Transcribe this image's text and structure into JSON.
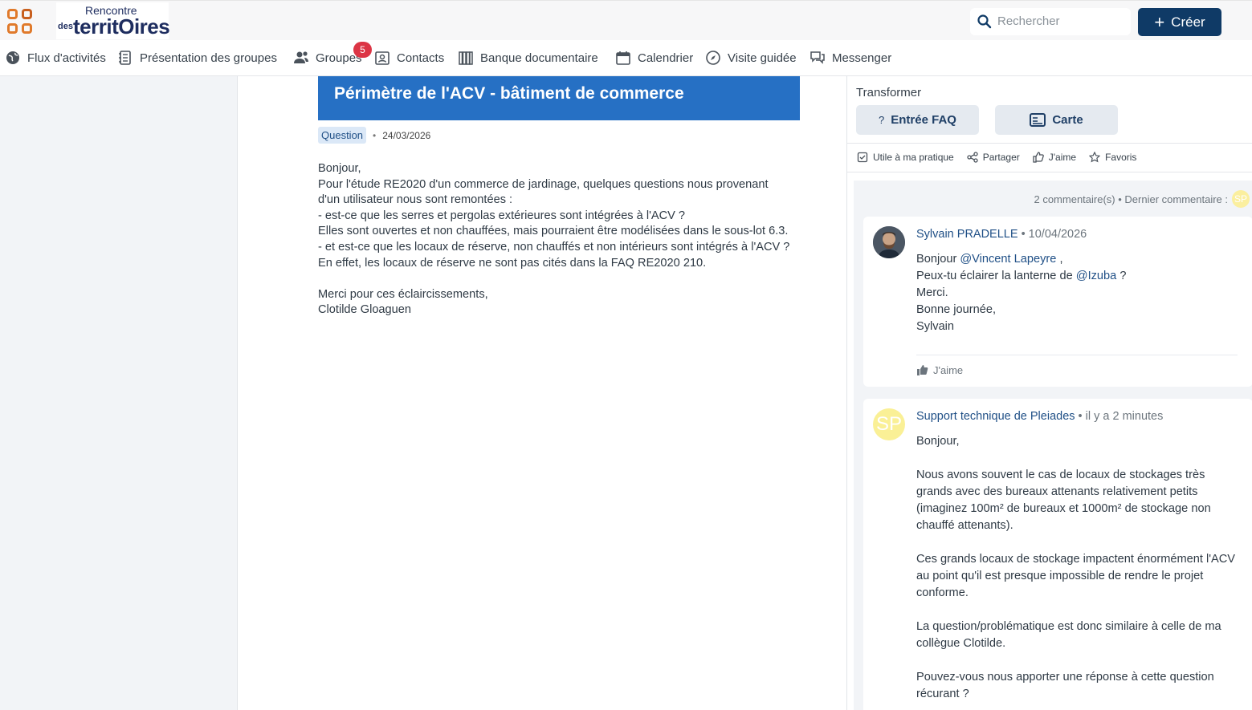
{
  "header": {
    "logo_top": "Rencontre",
    "logo_small": "des",
    "logo_main": "territOires",
    "search_placeholder": "Rechercher",
    "create_label": "Créer"
  },
  "nav": {
    "items": [
      {
        "label": "Flux d'activités",
        "icon": "globe-icon"
      },
      {
        "label": "Présentation des groupes",
        "icon": "notebook-icon"
      },
      {
        "label": "Groupes",
        "icon": "users-icon",
        "badge": "5"
      },
      {
        "label": "Contacts",
        "icon": "contact-card-icon"
      },
      {
        "label": "Banque documentaire",
        "icon": "library-icon"
      },
      {
        "label": "Calendrier",
        "icon": "calendar-icon"
      },
      {
        "label": "Visite guidée",
        "icon": "compass-icon"
      },
      {
        "label": "Messenger",
        "icon": "chat-icon"
      }
    ]
  },
  "post": {
    "title": "Périmètre de l'ACV - bâtiment de commerce",
    "tag": "Question",
    "date": "24/03/2026",
    "body": [
      "Bonjour,",
      "Pour l'étude RE2020 d'un commerce de jardinage, quelques questions nous provenant d'un utilisateur nous sont remontées :",
      "- est-ce que les serres et pergolas extérieures sont intégrées à l'ACV ?",
      "Elles sont ouvertes et non chauffées, mais pourraient être modélisées dans le sous-lot 6.3.",
      "- et est-ce que les locaux de réserve, non chauffés et non intérieurs sont intégrés à l'ACV ?",
      "En effet, les locaux de réserve ne sont pas cités dans la FAQ RE2020 210.",
      "",
      "Merci pour ces éclaircissements,",
      "Clotilde Gloaguen"
    ]
  },
  "sidebar_right": {
    "transform_label": "Transformer",
    "faq_button": "Entrée FAQ",
    "carte_button": "Carte",
    "actions": {
      "useful": "Utile à ma pratique",
      "share": "Partager",
      "like": "J'aime",
      "favorites": "Favoris"
    },
    "comments_summary": "2 commentaire(s) • Dernier commentaire :",
    "summary_avatar": "SP"
  },
  "comments": [
    {
      "author": "Sylvain PRADELLE",
      "date": "10/04/2026",
      "line1_prefix": "Bonjour ",
      "mention1": "@Vincent Lapeyre",
      "line1_suffix": " ,",
      "line2_prefix": "Peux-tu éclairer la lanterne de ",
      "mention2": "@Izuba",
      "line2_suffix": "  ?",
      "rest": [
        "Merci.",
        "Bonne journée,",
        "Sylvain"
      ],
      "like": "J'aime"
    },
    {
      "author": "Support technique de Pleiades",
      "date": "il y a 2 minutes",
      "avatar": "SP",
      "body": [
        "Bonjour,",
        "",
        "Nous avons souvent le cas de locaux de stockages très grands avec des bureaux attenants relativement petits (imaginez 100m² de bureaux et 1000m² de stockage non chauffé attenants).",
        "",
        "Ces grands locaux de stockage impactent énormément l'ACV au point qu'il est presque impossible de rendre le projet conforme.",
        "",
        "La question/problématique est donc similaire à celle de ma collègue Clotilde.",
        "",
        "Pouvez-vous nous apporter une réponse à cette question récurant ?"
      ]
    }
  ],
  "colors": {
    "brand_navy": "#0f3a66",
    "title_blue": "#2670c4",
    "accent_orange": "#e07a2b",
    "badge_red": "#dc3545"
  }
}
